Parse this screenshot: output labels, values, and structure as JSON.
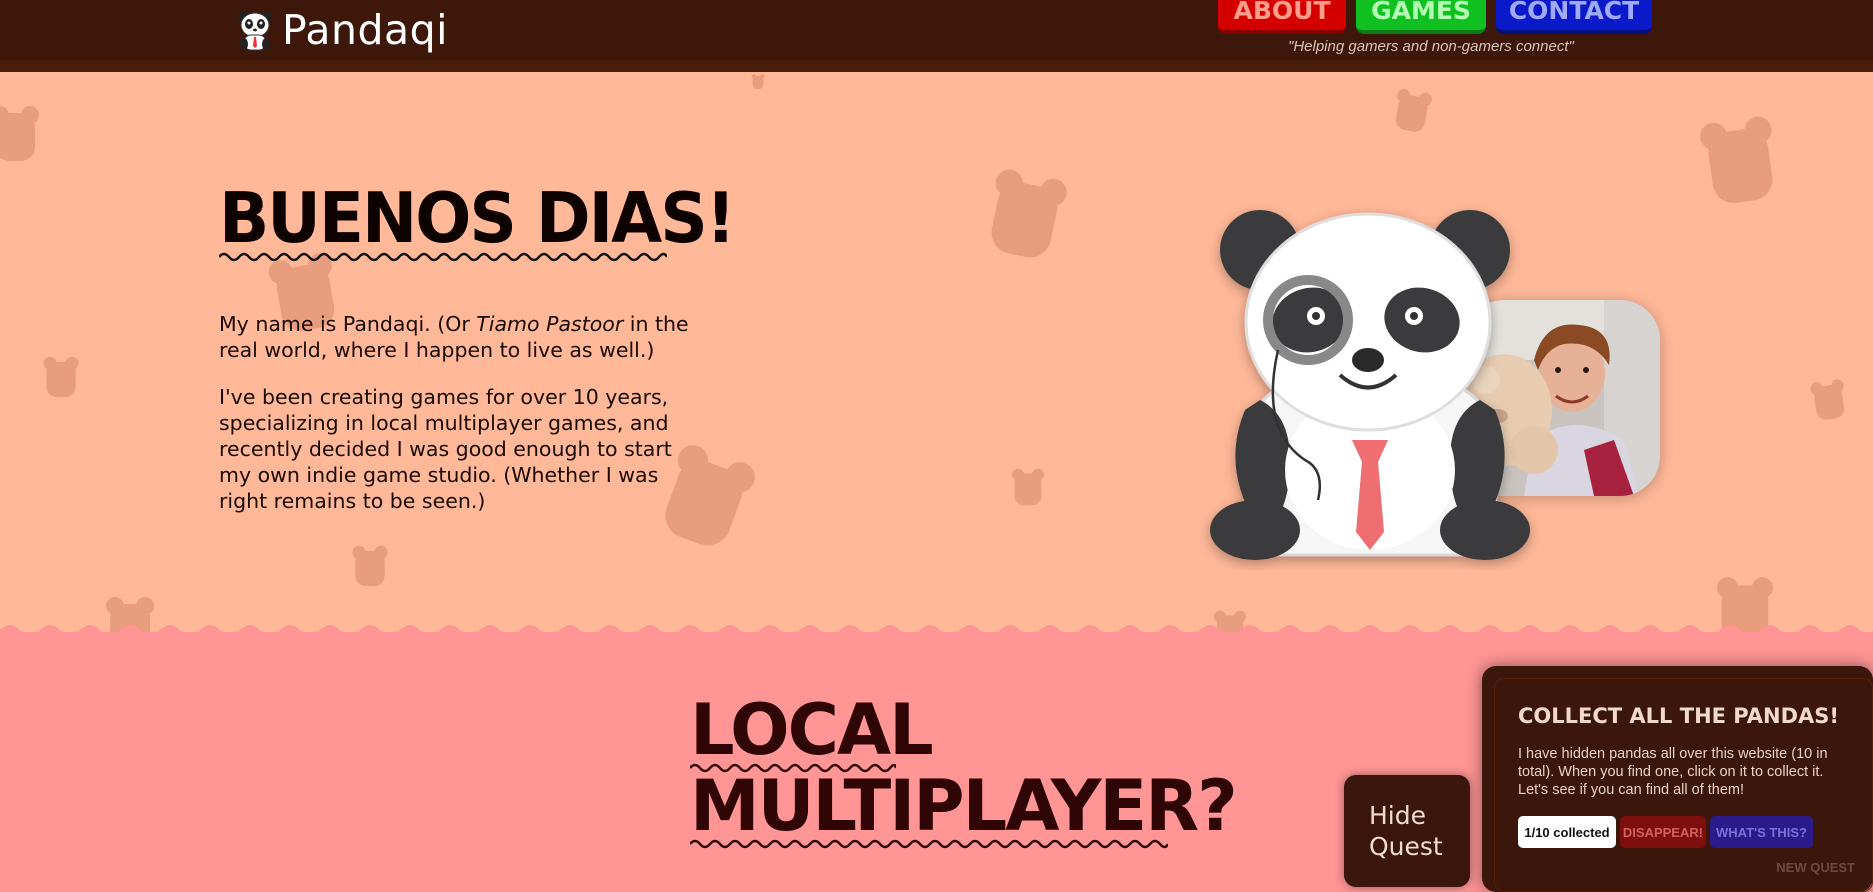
{
  "header": {
    "logo_text": "Pandaqi",
    "logo_icon": "panda-icon",
    "tagline": "\"Helping gamers and non-gamers connect\"",
    "nav": [
      {
        "label": "ABOUT",
        "color": "#d40000"
      },
      {
        "label": "GAMES",
        "color": "#10c021"
      },
      {
        "label": "CONTACT",
        "color": "#0a1ac8"
      }
    ]
  },
  "hero": {
    "title": "BUENOS DIAS!",
    "p1_a": "My name is Pandaqi. (Or ",
    "p1_em": "Tiamo Pastoor",
    "p1_b": " in the real world, where I happen to live as well.)",
    "p2": "I've been creating games for over 10 years, specializing in local multiplayer games, and recently decided I was good enough to start my own indie game studio. (Whether I was right remains to be seen.)"
  },
  "section2": {
    "title_line1": "LOCAL",
    "title_line2": "MULTIPLAYER?"
  },
  "hide_quest": {
    "line1": "Hide",
    "line2": "Quest"
  },
  "quest": {
    "title": "COLLECT ALL THE PANDAS!",
    "text": "I have hidden pandas all over this website (10 in total). When you find one, click on it to collect it. Let's see if you can find all of them!",
    "collected": "1/10 collected",
    "disappear": "DISAPPEAR!",
    "whats_this": "WHAT'S THIS?",
    "new_quest": "NEW QUEST"
  },
  "colors": {
    "header_bg": "#3d170a",
    "hero_bg": "#ffb898",
    "pink_bg": "#ff9595"
  }
}
